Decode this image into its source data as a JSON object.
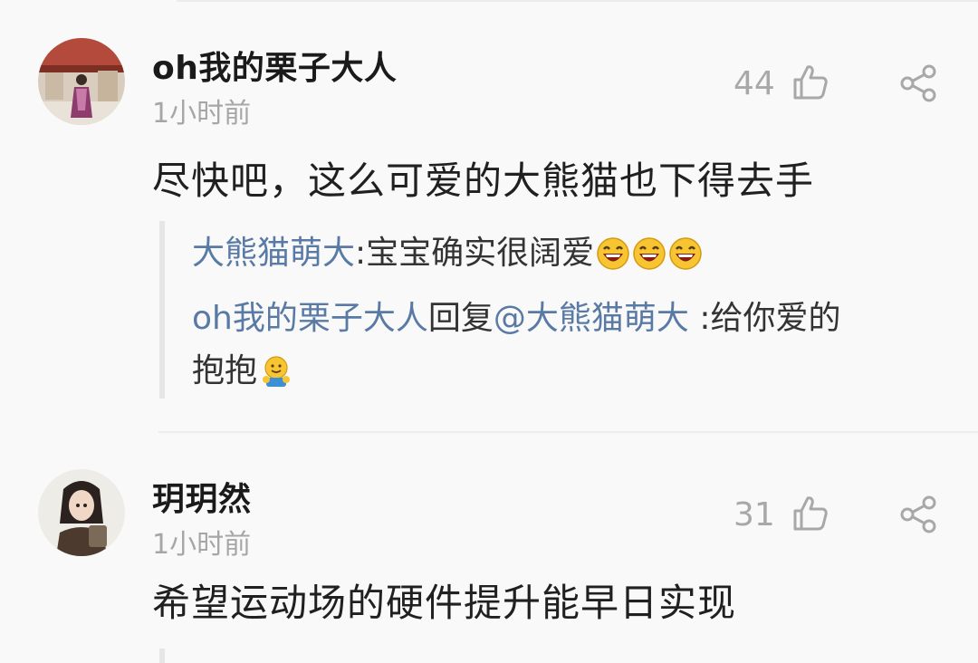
{
  "comments": [
    {
      "username": "oh我的栗子大人",
      "time": "1小时前",
      "likes": "44",
      "content": "尽快吧，这么可爱的大熊猫也下得去手",
      "replies": [
        {
          "author": "大熊猫萌大",
          "text": ":宝宝确实很阔爱"
        },
        {
          "author": "oh我的栗子大人",
          "reply_word": "回复",
          "mention": "@大熊猫萌大",
          "text": " :给你爱的",
          "continuation": "抱抱"
        }
      ]
    },
    {
      "username": "玥玥然",
      "time": "1小时前",
      "likes": "31",
      "content": "希望运动场的硬件提升能早日实现"
    }
  ],
  "icons": {
    "like": "thumbs-up-outline-icon",
    "share": "share-nodes-icon",
    "emoji_laugh": "laughing-emoji-icon",
    "emoji_hug": "hug-emoji-icon"
  },
  "colors": {
    "link": "#5a7aa6",
    "meta": "#a6a6a6",
    "background": "#f9f9f9"
  }
}
